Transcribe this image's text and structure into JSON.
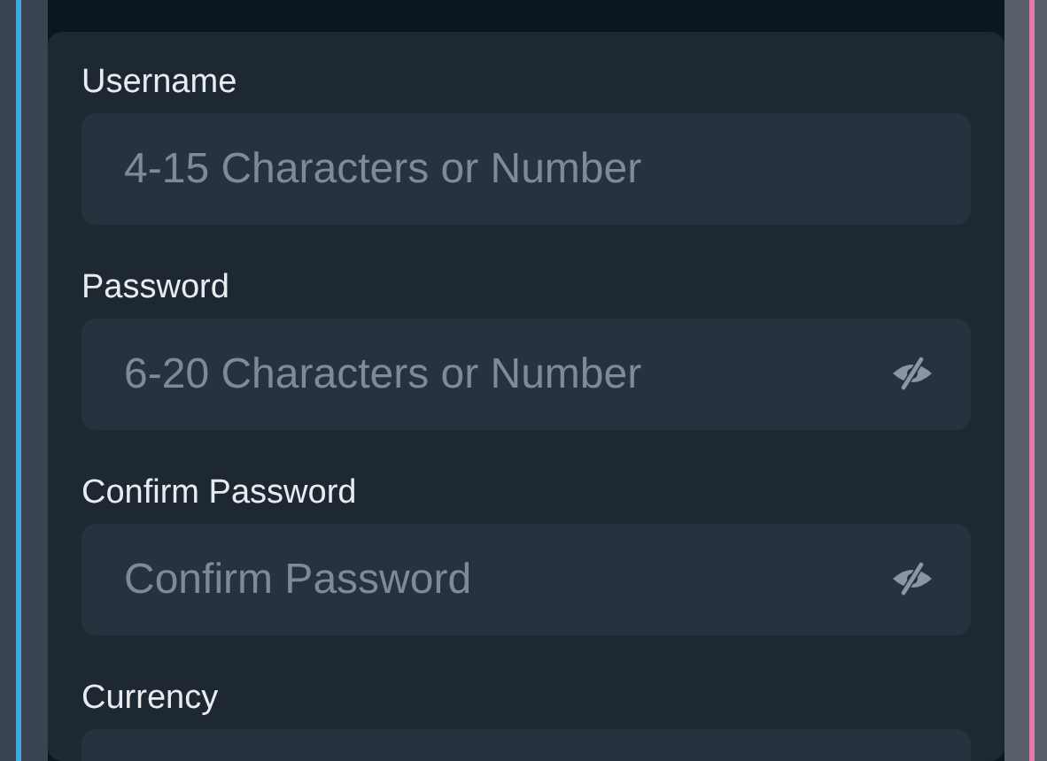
{
  "form": {
    "fields": [
      {
        "label": "Username",
        "placeholder": "4-15 Characters or Number",
        "kind": "text"
      },
      {
        "label": "Password",
        "placeholder": "6-20 Characters or Number",
        "kind": "password"
      },
      {
        "label": "Confirm Password",
        "placeholder": "Confirm Password",
        "kind": "password"
      },
      {
        "label": "Currency",
        "kind": "text"
      }
    ]
  }
}
